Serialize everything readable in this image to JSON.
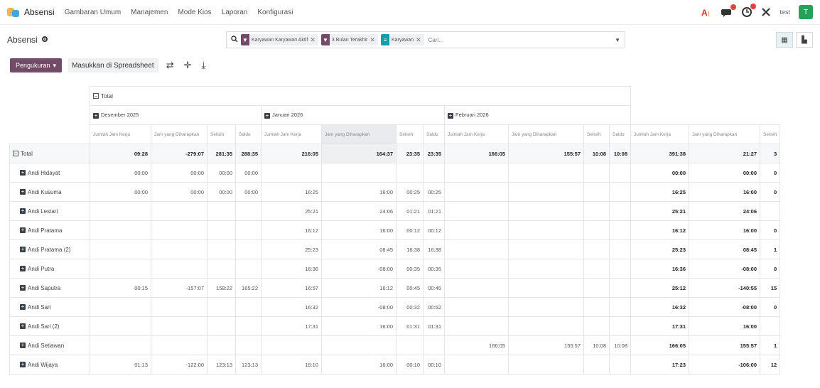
{
  "topbar": {
    "app_name": "Absensi",
    "menu": [
      "Gambaran Umum",
      "Manajemen",
      "Mode Kios",
      "Laporan",
      "Konfigurasi"
    ],
    "user_tag": "test",
    "avatar_letter": "T"
  },
  "control": {
    "breadcrumb": "Absensi",
    "facets": [
      {
        "label": "Karyawan Karyawan Aktif",
        "color": "#714b67",
        "icon": "filter-icon"
      },
      {
        "label": "3 Bulan Terakhir",
        "color": "#714b67",
        "icon": "filter-icon"
      },
      {
        "label": "Karyawan",
        "color": "#0fa0a8",
        "icon": "group-icon"
      }
    ],
    "search_placeholder": "Cari..."
  },
  "actions": {
    "measures_label": "Pengukuran",
    "spreadsheet_label": "Masukkan di Spreadsheet"
  },
  "pivot": {
    "total_label": "Total",
    "months": [
      "Desember 2025",
      "Januari 2026",
      "Februari 2026"
    ],
    "measures": [
      "Jumlah Jam Kerja",
      "Jam yang Diharapkan",
      "Selisih",
      "Saldo"
    ],
    "rows": [
      {
        "name": "Total",
        "total": true,
        "vals": [
          "09:28",
          "-279:07",
          "281:35",
          "288:35",
          "216:05",
          "164:37",
          "23:35",
          "23:35",
          "166:05",
          "155:57",
          "10:08",
          "10:08",
          "391:38",
          "21:27",
          "3"
        ]
      },
      {
        "name": "Andi Hidayat",
        "vals": [
          "00:00",
          "00:00",
          "00:00",
          "00:00",
          "",
          "",
          "",
          "",
          "",
          "",
          "",
          "",
          "00:00",
          "00:00",
          "0"
        ]
      },
      {
        "name": "Andi Kusuma",
        "vals": [
          "00:00",
          "00:00",
          "00:00",
          "00:00",
          "16:25",
          "16:00",
          "00:25",
          "00:25",
          "",
          "",
          "",
          "",
          "16:25",
          "16:00",
          "0"
        ]
      },
      {
        "name": "Andi Lestari",
        "vals": [
          "",
          "",
          "",
          "",
          "25:21",
          "24:06",
          "01:21",
          "01:21",
          "",
          "",
          "",
          "",
          "25:21",
          "24:06",
          ""
        ]
      },
      {
        "name": "Andi Pratama",
        "vals": [
          "",
          "",
          "",
          "",
          "16:12",
          "16:00",
          "00:12",
          "00:12",
          "",
          "",
          "",
          "",
          "16:12",
          "16:00",
          "0"
        ]
      },
      {
        "name": "Andi Pratama (2)",
        "vals": [
          "",
          "",
          "",
          "",
          "25:23",
          "08:45",
          "16:38",
          "16:38",
          "",
          "",
          "",
          "",
          "25:23",
          "08:45",
          "1"
        ]
      },
      {
        "name": "Andi Putra",
        "vals": [
          "",
          "",
          "",
          "",
          "16:36",
          "-08:00",
          "00:35",
          "00:35",
          "",
          "",
          "",
          "",
          "16:36",
          "-08:00",
          "0"
        ]
      },
      {
        "name": "Andi Saputra",
        "vals": [
          "00:15",
          "-157:07",
          "158:22",
          "165:22",
          "16:57",
          "16:12",
          "00:45",
          "00:45",
          "",
          "",
          "",
          "",
          "25:12",
          "-140:55",
          "15"
        ]
      },
      {
        "name": "Andi Sari",
        "vals": [
          "",
          "",
          "",
          "",
          "16:32",
          "-08:00",
          "00:32",
          "00:52",
          "",
          "",
          "",
          "",
          "16:32",
          "-08:00",
          "0"
        ]
      },
      {
        "name": "Andi Sari (2)",
        "vals": [
          "",
          "",
          "",
          "",
          "17:31",
          "16:00",
          "01:31",
          "01:31",
          "",
          "",
          "",
          "",
          "17:31",
          "16:00",
          ""
        ]
      },
      {
        "name": "Andi Setiawan",
        "vals": [
          "",
          "",
          "",
          "",
          "",
          "",
          "",
          "",
          "166:05",
          "155:57",
          "10:08",
          "10:08",
          "166:05",
          "155:57",
          "1"
        ]
      },
      {
        "name": "Andi Wijaya",
        "vals": [
          "01:13",
          "-122:00",
          "123:13",
          "123:13",
          "16:10",
          "16:00",
          "00:10",
          "00:10",
          "",
          "",
          "",
          "",
          "17:23",
          "-106:00",
          "12"
        ]
      }
    ]
  }
}
